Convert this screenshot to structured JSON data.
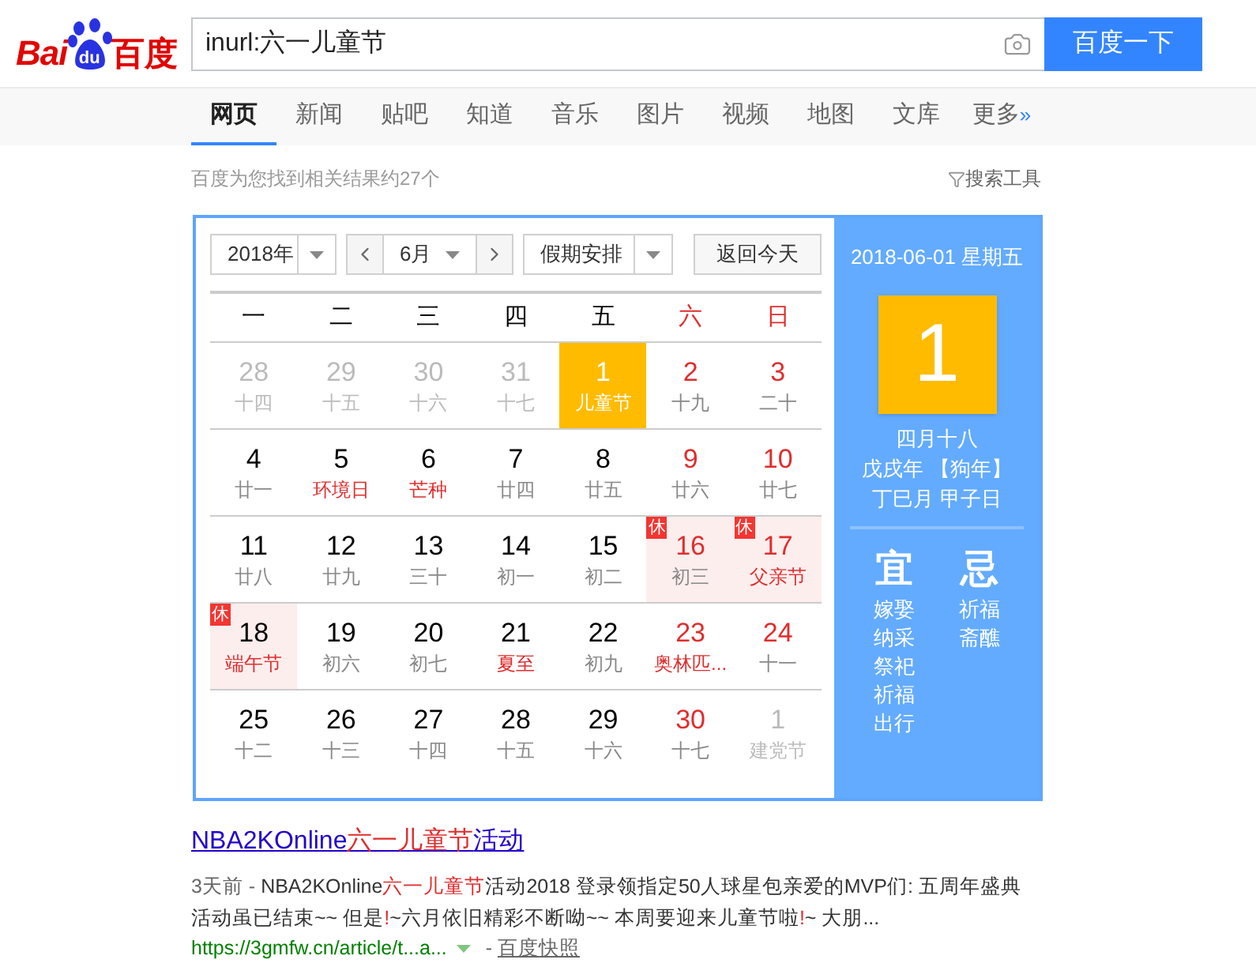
{
  "logo": {
    "left": "Bai",
    "paw": "du",
    "right": "百度"
  },
  "search": {
    "value": "inurl:六一儿童节",
    "button": "百度一下"
  },
  "tabs": [
    {
      "label": "网页",
      "selected": true
    },
    {
      "label": "新闻",
      "selected": false
    },
    {
      "label": "贴吧",
      "selected": false
    },
    {
      "label": "知道",
      "selected": false
    },
    {
      "label": "音乐",
      "selected": false
    },
    {
      "label": "图片",
      "selected": false
    },
    {
      "label": "视频",
      "selected": false
    },
    {
      "label": "地图",
      "selected": false
    },
    {
      "label": "文库",
      "selected": false
    },
    {
      "label": "更多",
      "selected": false,
      "suffix": "»"
    }
  ],
  "result_count": "百度为您找到相关结果约27个",
  "search_tools": "搜索工具",
  "calendar": {
    "year": "2018年",
    "month": "6月",
    "holiday": "假期安排",
    "today_button": "返回今天",
    "weekdays": [
      {
        "label": "一",
        "weekend": false
      },
      {
        "label": "二",
        "weekend": false
      },
      {
        "label": "三",
        "weekend": false
      },
      {
        "label": "四",
        "weekend": false
      },
      {
        "label": "五",
        "weekend": false
      },
      {
        "label": "六",
        "weekend": true
      },
      {
        "label": "日",
        "weekend": true
      }
    ],
    "days": [
      {
        "day": "28",
        "sub": "十四",
        "muted": true,
        "red_day": false,
        "red_sub": false,
        "selected": false
      },
      {
        "day": "29",
        "sub": "十五",
        "muted": true,
        "red_day": false,
        "red_sub": false,
        "selected": false
      },
      {
        "day": "30",
        "sub": "十六",
        "muted": true,
        "red_day": false,
        "red_sub": false,
        "selected": false
      },
      {
        "day": "31",
        "sub": "十七",
        "muted": true,
        "red_day": false,
        "red_sub": false,
        "selected": false
      },
      {
        "day": "1",
        "sub": "儿童节",
        "muted": false,
        "red_day": false,
        "red_sub": false,
        "selected": true
      },
      {
        "day": "2",
        "sub": "十九",
        "muted": false,
        "red_day": true,
        "red_sub": false,
        "selected": false
      },
      {
        "day": "3",
        "sub": "二十",
        "muted": false,
        "red_day": true,
        "red_sub": false,
        "selected": false
      },
      {
        "day": "4",
        "sub": "廿一",
        "muted": false,
        "red_day": false,
        "red_sub": false,
        "selected": false
      },
      {
        "day": "5",
        "sub": "环境日",
        "muted": false,
        "red_day": false,
        "red_sub": true,
        "selected": false
      },
      {
        "day": "6",
        "sub": "芒种",
        "muted": false,
        "red_day": false,
        "red_sub": true,
        "selected": false
      },
      {
        "day": "7",
        "sub": "廿四",
        "muted": false,
        "red_day": false,
        "red_sub": false,
        "selected": false
      },
      {
        "day": "8",
        "sub": "廿五",
        "muted": false,
        "red_day": false,
        "red_sub": false,
        "selected": false
      },
      {
        "day": "9",
        "sub": "廿六",
        "muted": false,
        "red_day": true,
        "red_sub": false,
        "selected": false
      },
      {
        "day": "10",
        "sub": "廿七",
        "muted": false,
        "red_day": true,
        "red_sub": false,
        "selected": false
      },
      {
        "day": "11",
        "sub": "廿八",
        "muted": false,
        "red_day": false,
        "red_sub": false,
        "selected": false
      },
      {
        "day": "12",
        "sub": "廿九",
        "muted": false,
        "red_day": false,
        "red_sub": false,
        "selected": false
      },
      {
        "day": "13",
        "sub": "三十",
        "muted": false,
        "red_day": false,
        "red_sub": false,
        "selected": false
      },
      {
        "day": "14",
        "sub": "初一",
        "muted": false,
        "red_day": false,
        "red_sub": false,
        "selected": false
      },
      {
        "day": "15",
        "sub": "初二",
        "muted": false,
        "red_day": false,
        "red_sub": false,
        "selected": false
      },
      {
        "day": "16",
        "sub": "初三",
        "muted": false,
        "red_day": true,
        "red_sub": false,
        "selected": false,
        "rest": "休"
      },
      {
        "day": "17",
        "sub": "父亲节",
        "muted": false,
        "red_day": true,
        "red_sub": true,
        "selected": false,
        "rest": "休"
      },
      {
        "day": "18",
        "sub": "端午节",
        "muted": false,
        "red_day": false,
        "red_sub": true,
        "selected": false,
        "rest": "休"
      },
      {
        "day": "19",
        "sub": "初六",
        "muted": false,
        "red_day": false,
        "red_sub": false,
        "selected": false
      },
      {
        "day": "20",
        "sub": "初七",
        "muted": false,
        "red_day": false,
        "red_sub": false,
        "selected": false
      },
      {
        "day": "21",
        "sub": "夏至",
        "muted": false,
        "red_day": false,
        "red_sub": true,
        "selected": false
      },
      {
        "day": "22",
        "sub": "初九",
        "muted": false,
        "red_day": false,
        "red_sub": false,
        "selected": false
      },
      {
        "day": "23",
        "sub": "奥林匹...",
        "muted": false,
        "red_day": true,
        "red_sub": true,
        "selected": false
      },
      {
        "day": "24",
        "sub": "十一",
        "muted": false,
        "red_day": true,
        "red_sub": false,
        "selected": false
      },
      {
        "day": "25",
        "sub": "十二",
        "muted": false,
        "red_day": false,
        "red_sub": false,
        "selected": false
      },
      {
        "day": "26",
        "sub": "十三",
        "muted": false,
        "red_day": false,
        "red_sub": false,
        "selected": false
      },
      {
        "day": "27",
        "sub": "十四",
        "muted": false,
        "red_day": false,
        "red_sub": false,
        "selected": false
      },
      {
        "day": "28",
        "sub": "十五",
        "muted": false,
        "red_day": false,
        "red_sub": false,
        "selected": false
      },
      {
        "day": "29",
        "sub": "十六",
        "muted": false,
        "red_day": false,
        "red_sub": false,
        "selected": false
      },
      {
        "day": "30",
        "sub": "十七",
        "muted": false,
        "red_day": true,
        "red_sub": false,
        "selected": false
      },
      {
        "day": "1",
        "sub": "建党节",
        "muted": true,
        "red_day": false,
        "red_sub": false,
        "selected": false
      }
    ],
    "panel": {
      "date": "2018-06-01 星期五",
      "big_day": "1",
      "lunar": [
        "四月十八",
        "戊戌年 【狗年】",
        "丁巳月 甲子日"
      ],
      "good": {
        "title": "宜",
        "items": [
          "嫁娶",
          "纳采",
          "祭祀",
          "祈福",
          "出行"
        ]
      },
      "bad": {
        "title": "忌",
        "items": [
          "祈福",
          "斋醮"
        ]
      }
    }
  },
  "result": {
    "title": [
      {
        "text": "NBA2KOnline",
        "hit": false
      },
      {
        "text": "六一儿童节",
        "hit": true
      },
      {
        "text": "活动",
        "hit": false
      }
    ],
    "date": "3天前 - ",
    "snippet": [
      [
        {
          "text": "NBA2KOnline",
          "hit": false
        },
        {
          "text": "六一儿童节",
          "hit": true
        },
        {
          "text": "活动2018 登录领指定50人球星包亲爱的MVP们: 五周年盛典",
          "hit": false
        }
      ],
      [
        {
          "text": "活动虽已结束~~ 但是",
          "hit": false
        },
        {
          "text": "!",
          "hit": true
        },
        {
          "text": "~六月依旧精彩不断呦~~ 本周要迎来儿童节啦",
          "hit": false
        },
        {
          "text": "!",
          "hit": true
        },
        {
          "text": "~ 大朋...",
          "hit": false
        }
      ]
    ],
    "url": "https://3gmfw.cn/article/t...a...",
    "separator": " - ",
    "cache": "百度快照"
  }
}
